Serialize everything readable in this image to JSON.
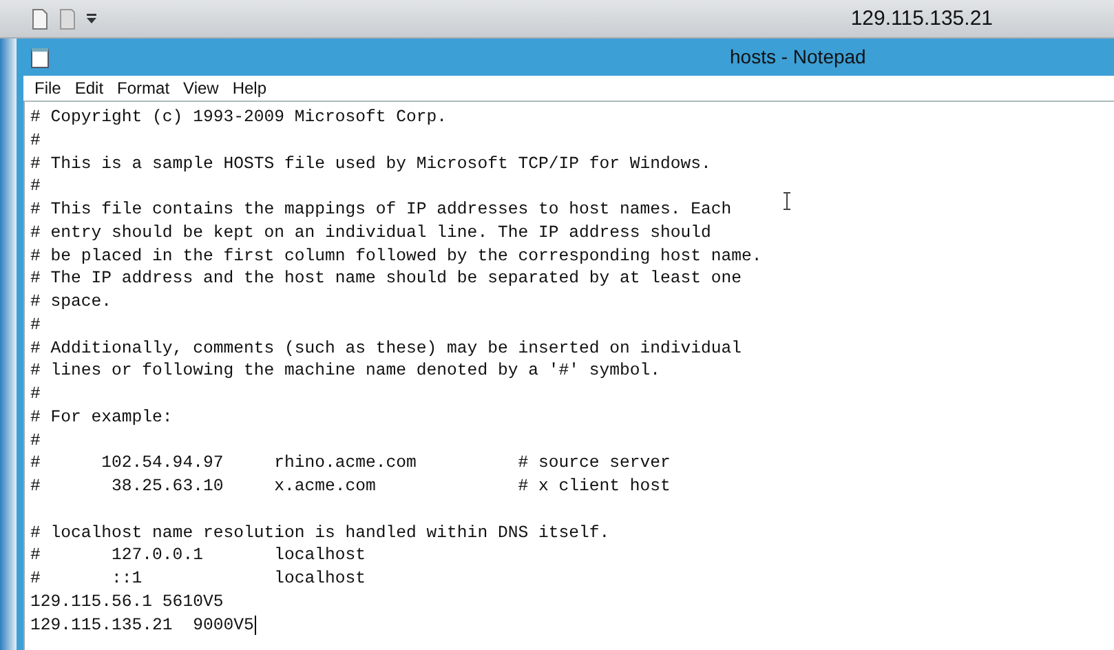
{
  "remote_bar": {
    "address": "129.115.135.21"
  },
  "window": {
    "title": "hosts - Notepad"
  },
  "menu": [
    "File",
    "Edit",
    "Format",
    "View",
    "Help"
  ],
  "editor": {
    "content": "# Copyright (c) 1993-2009 Microsoft Corp.\n#\n# This is a sample HOSTS file used by Microsoft TCP/IP for Windows.\n#\n# This file contains the mappings of IP addresses to host names. Each\n# entry should be kept on an individual line. The IP address should\n# be placed in the first column followed by the corresponding host name.\n# The IP address and the host name should be separated by at least one\n# space.\n#\n# Additionally, comments (such as these) may be inserted on individual\n# lines or following the machine name denoted by a '#' symbol.\n#\n# For example:\n#\n#      102.54.94.97     rhino.acme.com          # source server\n#       38.25.63.10     x.acme.com              # x client host\n\n# localhost name resolution is handled within DNS itself.\n#       127.0.0.1       localhost\n#       ::1             localhost\n129.115.56.1 5610V5\n129.115.135.21  9000V5"
  }
}
